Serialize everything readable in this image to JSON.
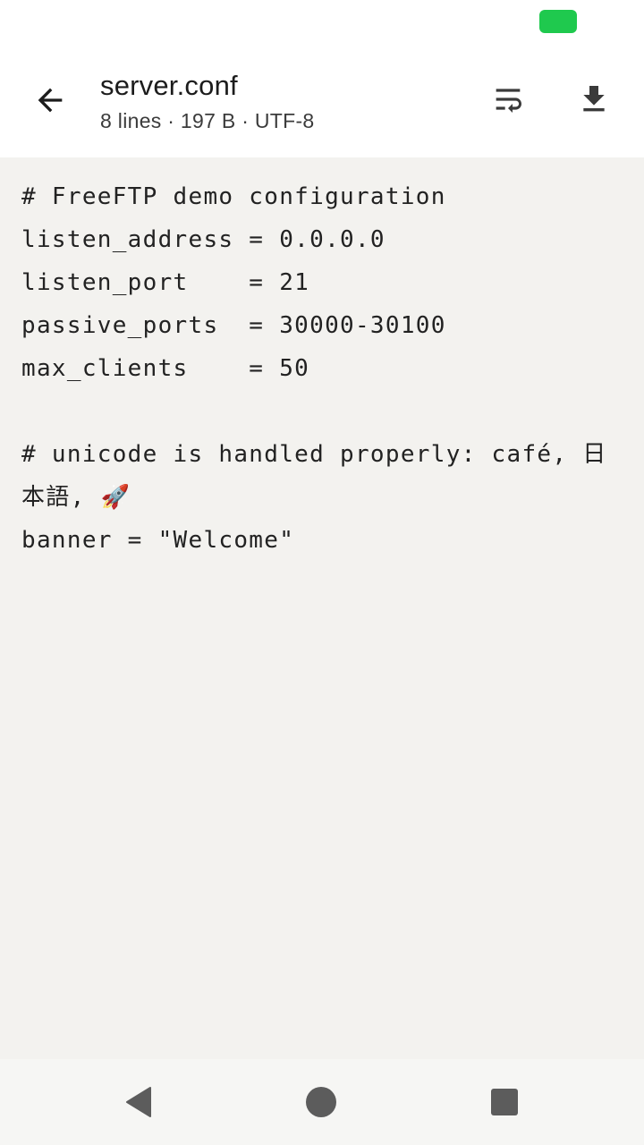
{
  "status_bar": {
    "battery_color": "#1fc94e"
  },
  "app_bar": {
    "back_icon": "arrow-back-icon",
    "title": "server.conf",
    "subtitle": "8 lines · 197 B · UTF-8",
    "actions": [
      {
        "icon": "wrap-text-icon"
      },
      {
        "icon": "download-icon"
      }
    ]
  },
  "editor": {
    "background": "#f3f2ef",
    "lines": [
      "# FreeFTP demo configuration",
      "listen_address = 0.0.0.0",
      "listen_port    = 21",
      "passive_ports  = 30000-30100",
      "max_clients    = 50",
      "",
      "# unicode is handled properly: café, 日本語, 🚀",
      "banner = \"Welcome\""
    ]
  },
  "nav_bar": {
    "items": [
      {
        "icon": "nav-back-icon"
      },
      {
        "icon": "nav-home-icon"
      },
      {
        "icon": "nav-recents-icon"
      }
    ]
  }
}
